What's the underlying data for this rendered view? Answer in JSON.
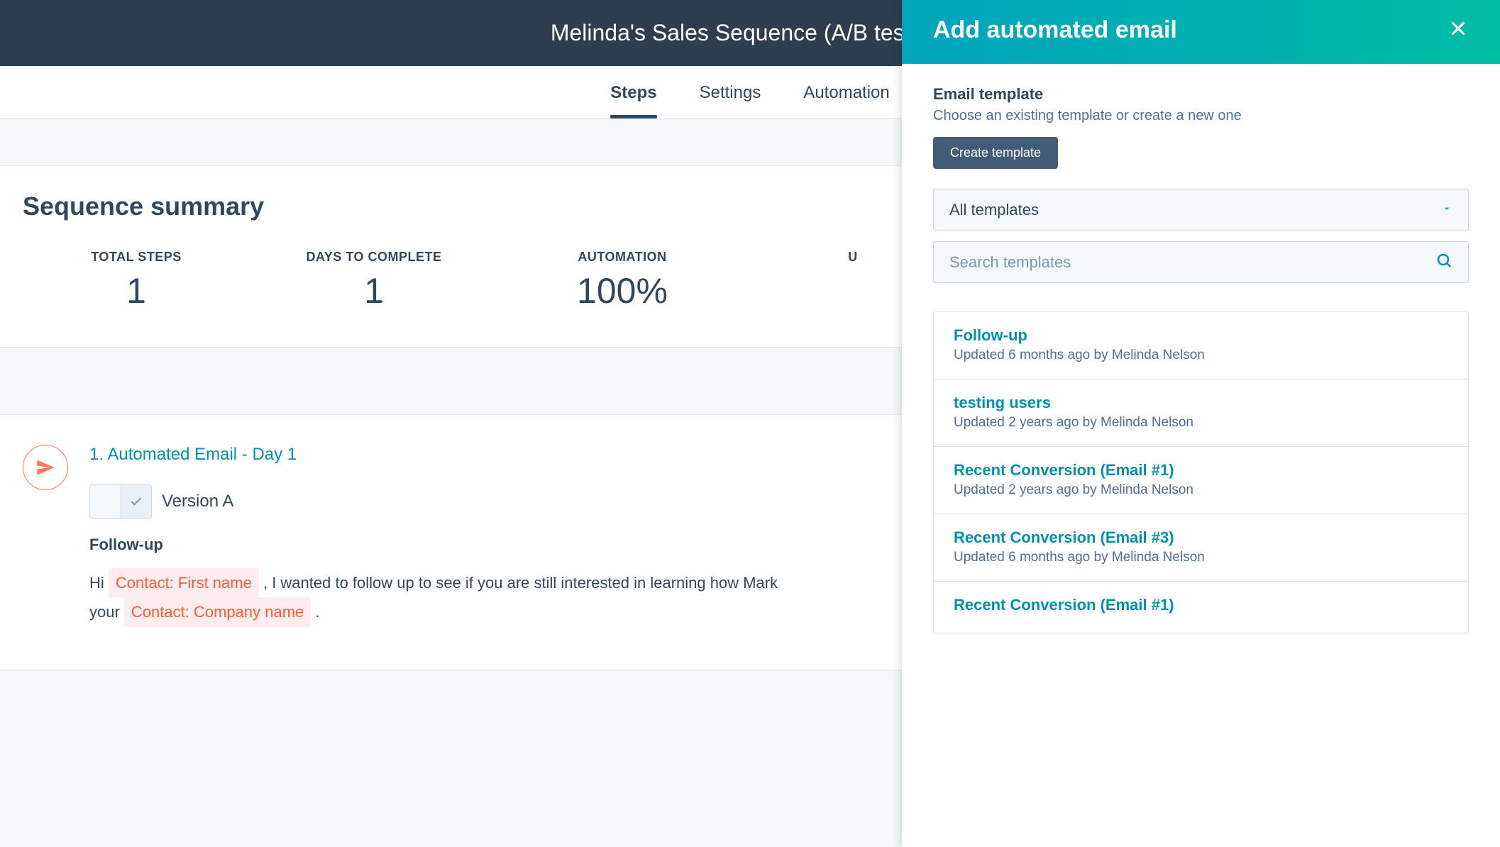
{
  "header": {
    "title": "Melinda's Sales Sequence (A/B test)"
  },
  "tabs": {
    "items": [
      "Steps",
      "Settings",
      "Automation"
    ],
    "active": 0
  },
  "summary": {
    "title": "Sequence summary",
    "stats": [
      {
        "label": "TOTAL STEPS",
        "value": "1"
      },
      {
        "label": "DAYS TO COMPLETE",
        "value": "1"
      },
      {
        "label": "AUTOMATION",
        "value": "100%"
      },
      {
        "label": "U",
        "value": ""
      }
    ]
  },
  "step": {
    "title": "1. Automated Email - Day 1",
    "version_label": "Version A",
    "email_subject": "Follow-up",
    "body_pre": "Hi ",
    "token1": "Contact: First name",
    "body_mid": " , I wanted to follow up to see if you are still interested in learning how Mark",
    "body_line2_pre": "your ",
    "token2": "Contact: Company name",
    "body_line2_post": " ."
  },
  "panel": {
    "title": "Add automated email",
    "section_title": "Email template",
    "section_sub": "Choose an existing template or create a new one",
    "create_btn": "Create template",
    "filter_label": "All templates",
    "search_placeholder": "Search templates",
    "templates": [
      {
        "name": "Follow-up",
        "meta": "Updated 6 months ago by Melinda Nelson"
      },
      {
        "name": "testing users",
        "meta": "Updated 2 years ago by Melinda Nelson"
      },
      {
        "name": "Recent Conversion (Email #1)",
        "meta": "Updated 2 years ago by Melinda Nelson"
      },
      {
        "name": "Recent Conversion (Email #3)",
        "meta": "Updated 6 months ago by Melinda Nelson"
      },
      {
        "name": "Recent Conversion (Email #1)",
        "meta": ""
      }
    ]
  }
}
